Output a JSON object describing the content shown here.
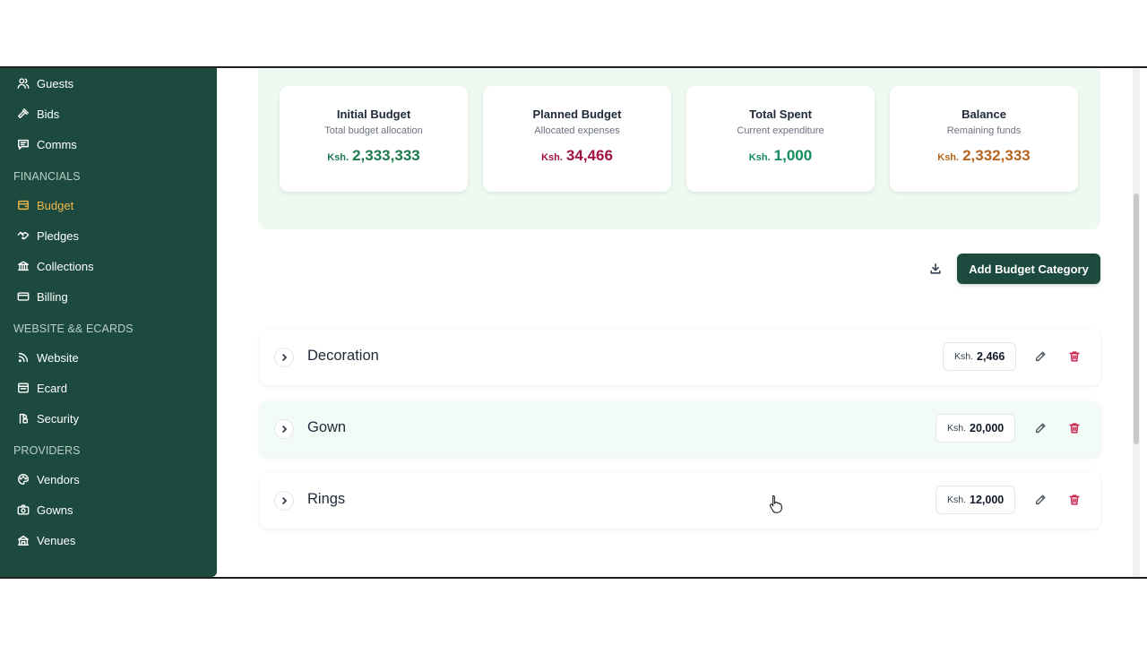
{
  "sidebar": {
    "items_top": [
      {
        "label": "Guests",
        "icon": "users-icon"
      },
      {
        "label": "Bids",
        "icon": "gavel-icon"
      },
      {
        "label": "Comms",
        "icon": "message-icon"
      }
    ],
    "sections": [
      {
        "label": "FINANCIALS",
        "items": [
          {
            "label": "Budget",
            "icon": "budget-icon",
            "active": true
          },
          {
            "label": "Pledges",
            "icon": "handshake-icon"
          },
          {
            "label": "Collections",
            "icon": "bank-icon"
          },
          {
            "label": "Billing",
            "icon": "credit-card-icon"
          }
        ]
      },
      {
        "label": "WEBSITE && ECARDS",
        "items": [
          {
            "label": "Website",
            "icon": "rss-icon"
          },
          {
            "label": "Ecard",
            "icon": "ecard-icon"
          },
          {
            "label": "Security",
            "icon": "security-icon"
          }
        ]
      },
      {
        "label": "PROVIDERS",
        "items": [
          {
            "label": "Vendors",
            "icon": "palette-icon"
          },
          {
            "label": "Gowns",
            "icon": "camera-icon"
          },
          {
            "label": "Venues",
            "icon": "venue-icon"
          }
        ]
      }
    ],
    "colors": {
      "background": "#1c4a3f",
      "active": "#f2b84b"
    }
  },
  "summary": {
    "cards": [
      {
        "title": "Initial Budget",
        "subtitle": "Total budget allocation",
        "currency": "Ksh.",
        "amount": "2,333,333",
        "color": "#1c7a4f"
      },
      {
        "title": "Planned Budget",
        "subtitle": "Allocated expenses",
        "currency": "Ksh.",
        "amount": "34,466",
        "color": "#a3123f"
      },
      {
        "title": "Total Spent",
        "subtitle": "Current expenditure",
        "currency": "Ksh.",
        "amount": "1,000",
        "color": "#138a5c"
      },
      {
        "title": "Balance",
        "subtitle": "Remaining funds",
        "currency": "Ksh.",
        "amount": "2,332,333",
        "color": "#b7651c"
      }
    ]
  },
  "toolbar": {
    "download_icon": "download-icon",
    "add_label": "Add Budget Category"
  },
  "categories": [
    {
      "name": "Decoration",
      "currency": "Ksh.",
      "amount": "2,466"
    },
    {
      "name": "Gown",
      "currency": "Ksh.",
      "amount": "20,000"
    },
    {
      "name": "Rings",
      "currency": "Ksh.",
      "amount": "12,000"
    }
  ]
}
